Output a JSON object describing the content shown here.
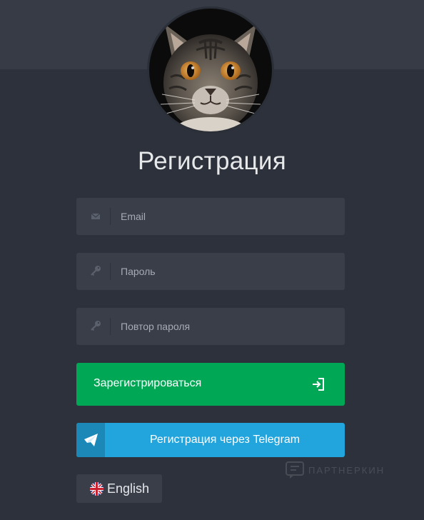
{
  "page": {
    "title": "Регистрация"
  },
  "avatar": {
    "alt": "cat avatar"
  },
  "form": {
    "email": {
      "placeholder": "Email",
      "value": "",
      "icon": "envelope-icon"
    },
    "password": {
      "placeholder": "Пароль",
      "value": "",
      "icon": "key-icon"
    },
    "password_repeat": {
      "placeholder": "Повтор пароля",
      "value": "",
      "icon": "key-icon"
    }
  },
  "buttons": {
    "register_label": "Зарегистрироваться",
    "register_icon": "sign-in-icon",
    "telegram_label": "Регистрация через Telegram",
    "telegram_icon": "telegram-plane-icon"
  },
  "language": {
    "label": "English",
    "flag": "uk-flag-icon"
  },
  "watermark": {
    "text": "ПАРТНЕРКИН"
  },
  "colors": {
    "background": "#2d313b",
    "field": "#393e49",
    "register_green": "#00a856",
    "telegram_blue": "#22a5dd"
  }
}
